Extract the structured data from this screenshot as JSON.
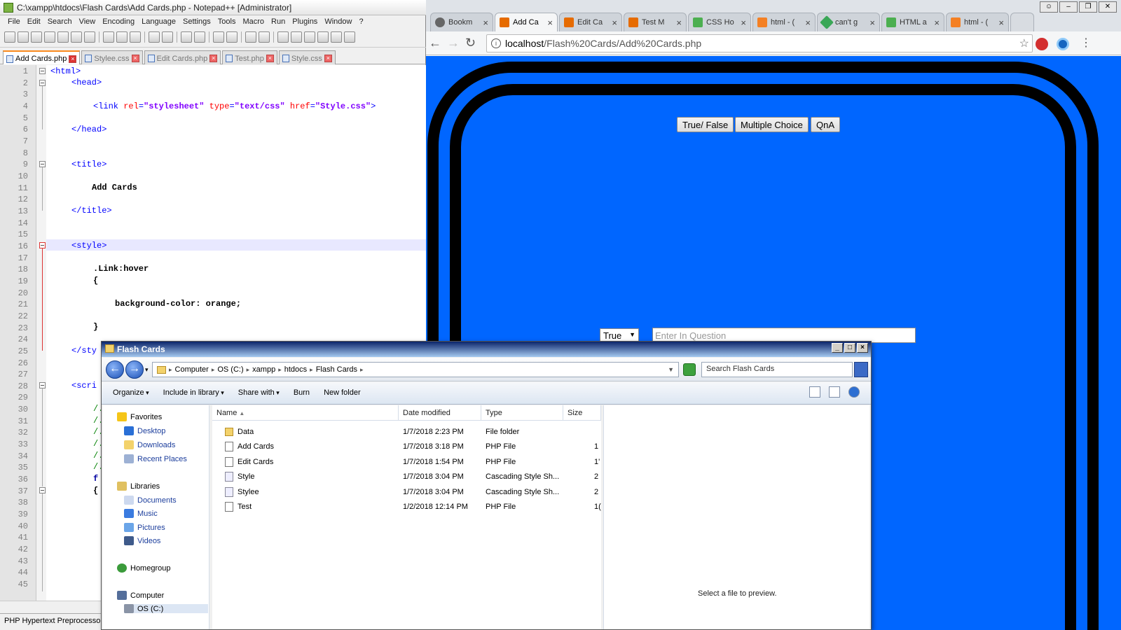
{
  "notepad": {
    "title": "C:\\xampp\\htdocs\\Flash Cards\\Add Cards.php - Notepad++ [Administrator]",
    "menu": [
      "File",
      "Edit",
      "Search",
      "View",
      "Encoding",
      "Language",
      "Settings",
      "Tools",
      "Macro",
      "Run",
      "Plugins",
      "Window",
      "?"
    ],
    "tabs": [
      "Add Cards.php",
      "Stylee.css",
      "Edit Cards.php",
      "Test.php",
      "Style.css"
    ],
    "line_numbers": [
      "1",
      "2",
      "3",
      "4",
      "5",
      "6",
      "7",
      "8",
      "9",
      "10",
      "11",
      "12",
      "13",
      "14",
      "15",
      "16",
      "17",
      "18",
      "19",
      "20",
      "21",
      "22",
      "23",
      "24",
      "25",
      "26",
      "27",
      "28",
      "29",
      "30",
      "31",
      "32",
      "33",
      "34",
      "35",
      "36",
      "37",
      "38",
      "39",
      "40",
      "41",
      "42",
      "43",
      "44",
      "45"
    ],
    "code": {
      "l1": "<html>",
      "l2": "<head>",
      "l4_tag_open": "<link ",
      "l4_attr1": "rel",
      "l4_eq1": "=",
      "l4_val1": "\"stylesheet\"",
      "l4_attr2": "type",
      "l4_eq2": "=",
      "l4_val2": "\"text/css\"",
      "l4_attr3": "href",
      "l4_eq3": "=",
      "l4_val3": "\"Style.css\"",
      "l4_close": ">",
      "l6": "</head>",
      "l9": "<title>",
      "l11": "Add Cards",
      "l13": "</title>",
      "l16": "<style>",
      "l18": ".Link:hover",
      "l19": "{",
      "l21": "background-color: orange;",
      "l23": "}",
      "l25": "</sty",
      "l28": "<scri",
      "l30": "/.",
      "l31": "/.",
      "l32": "/.",
      "l33": "/.",
      "l34": "/.",
      "l35": "/.",
      "l36": "f",
      "l37": "{"
    },
    "status": "PHP Hypertext Preprocessor"
  },
  "chrome": {
    "tabs": [
      {
        "label": "Bookm",
        "icon": "bookmark-icon"
      },
      {
        "label": "Add Ca",
        "icon": "xampp-icon"
      },
      {
        "label": "Edit Ca",
        "icon": "xampp-icon"
      },
      {
        "label": "Test M",
        "icon": "xampp-icon"
      },
      {
        "label": "CSS Ho",
        "icon": "w3-icon"
      },
      {
        "label": "html - (",
        "icon": "stackoverflow-icon"
      },
      {
        "label": "can't g",
        "icon": "angular-icon"
      },
      {
        "label": "HTML a",
        "icon": "w3-icon"
      },
      {
        "label": "html - (",
        "icon": "stackoverflow-icon"
      }
    ],
    "url_host": "localhost",
    "url_path": "/Flash%20Cards/Add%20Cards.php",
    "page": {
      "buttons": [
        "True/ False",
        "Multiple Choice",
        "QnA"
      ],
      "select_value": "True",
      "question_placeholder": "Enter In Question",
      "background": "#0066ff"
    }
  },
  "explorer": {
    "title": "Flash Cards",
    "breadcrumb": [
      "Computer",
      "OS (C:)",
      "xampp",
      "htdocs",
      "Flash Cards"
    ],
    "search_placeholder": "Search Flash Cards",
    "commands": [
      "Organize",
      "Include in library",
      "Share with",
      "Burn",
      "New folder"
    ],
    "nav": {
      "favorites": "Favorites",
      "fav_items": [
        "Desktop",
        "Downloads",
        "Recent Places"
      ],
      "libraries": "Libraries",
      "lib_items": [
        "Documents",
        "Music",
        "Pictures",
        "Videos"
      ],
      "homegroup": "Homegroup",
      "computer": "Computer",
      "drive": "OS (C:)"
    },
    "columns": [
      "Name",
      "Date modified",
      "Type",
      "Size"
    ],
    "files": [
      {
        "name": "Data",
        "date": "1/7/2018 2:23 PM",
        "type": "File folder",
        "size": "",
        "kind": "folder"
      },
      {
        "name": "Add Cards",
        "date": "1/7/2018 3:18 PM",
        "type": "PHP File",
        "size": "1",
        "kind": "php"
      },
      {
        "name": "Edit Cards",
        "date": "1/7/2018 1:54 PM",
        "type": "PHP File",
        "size": "1'",
        "kind": "php"
      },
      {
        "name": "Style",
        "date": "1/7/2018 3:04 PM",
        "type": "Cascading Style Sh...",
        "size": "2",
        "kind": "css"
      },
      {
        "name": "Stylee",
        "date": "1/7/2018 3:04 PM",
        "type": "Cascading Style Sh...",
        "size": "2",
        "kind": "css"
      },
      {
        "name": "Test",
        "date": "1/2/2018 12:14 PM",
        "type": "PHP File",
        "size": "1(",
        "kind": "php"
      }
    ],
    "preview_text": "Select a file to preview."
  }
}
